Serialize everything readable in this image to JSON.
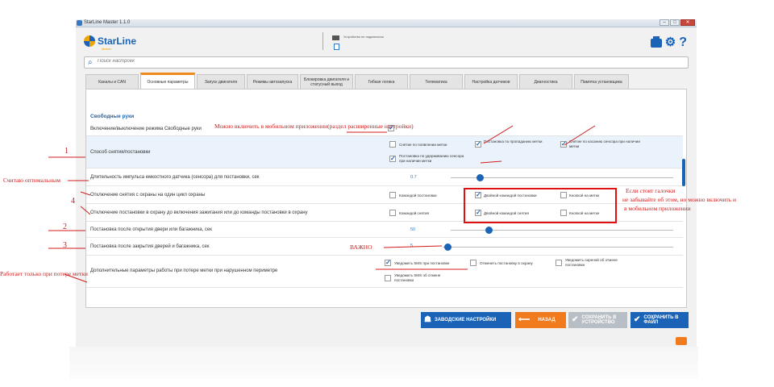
{
  "window": {
    "title": "StarLine Master 1.1.0"
  },
  "app": {
    "brand": "StarLine",
    "brand_sub": "Master",
    "device_status": "Устройство не подключено"
  },
  "search": {
    "placeholder": "Поиск настроек"
  },
  "tabs": [
    {
      "label": "Каналы и CAN",
      "active": false
    },
    {
      "label": "Основные параметры",
      "active": true
    },
    {
      "label": "Запуск двигателя",
      "active": false
    },
    {
      "label": "Режимы автозапуска",
      "active": false
    },
    {
      "label": "Блокировка двигателя и статусный выход",
      "active": false
    },
    {
      "label": "Гибкая логика",
      "active": false
    },
    {
      "label": "Телематика",
      "active": false
    },
    {
      "label": "Настройка датчиков",
      "active": false
    },
    {
      "label": "Диагностика",
      "active": false
    },
    {
      "label": "Памятка установщика",
      "active": false
    }
  ],
  "section": {
    "title": "Свободные руки"
  },
  "rows": {
    "hands_free": {
      "label": "Включение/выключение режима Свободные руки",
      "checked": true
    },
    "method": {
      "label": "Способ снятия/постановки",
      "options": [
        {
          "label": "Снятие по появлении метки",
          "checked": false
        },
        {
          "label": "Постановка по пропаданию метки",
          "checked": true
        },
        {
          "label": "Снятие по касанию сенсора при наличии метки",
          "checked": true
        },
        {
          "label": "Постановка по удерживанию сенсора при наличии метки",
          "checked": true
        }
      ]
    },
    "pulse": {
      "label": "Длительность импульса емкостного датчика (сенсора) для постановки, сек",
      "value": "0.7",
      "fraction": 0.13
    },
    "disarm_once": {
      "label": "Отключение снятия с охраны на один цикл охраны",
      "options": [
        {
          "label": "Командой постановки",
          "checked": false
        },
        {
          "label": "Двойной командой постановки",
          "checked": true
        },
        {
          "label": "Кнопкой на метке",
          "checked": false
        }
      ]
    },
    "arm_off": {
      "label": "Отключение постановки в охрану до включения зажигания или до команды постановки в охрану",
      "options": [
        {
          "label": "Командой снятия",
          "checked": false
        },
        {
          "label": "Двойной командой снятия",
          "checked": true
        },
        {
          "label": "Кнопкой на метке",
          "checked": false
        }
      ]
    },
    "after_open": {
      "label": "Постановка после открытия двери или багажника, сек",
      "value": "50",
      "fraction": 0.17
    },
    "after_close": {
      "label": "Постановка после закрытия дверей и багажника, сек",
      "value": "5",
      "fraction": 0.02
    },
    "tag_loss": {
      "label": "Дополнительные параметры работы при потере метки при нарушенном периметре",
      "options": [
        {
          "label": "Уведомить SMS при постановке",
          "checked": true
        },
        {
          "label": "Отменить постановку в охрану",
          "checked": false
        },
        {
          "label": "Уведомить сиреной об отмене постановки",
          "checked": false
        },
        {
          "label": "Уведомить SMS об отмене постановки",
          "checked": false
        }
      ]
    }
  },
  "buttons": {
    "factory": "ЗАВОДСКИЕ НАСТРОЙКИ",
    "back": "НАЗАД",
    "save_device": "СОХРАНИТЬ В УСТРОЙСТВО",
    "save_file": "СОХРАНИТЬ В ФАЙЛ"
  },
  "annotations": {
    "app_note": "Можно включить в мобильном приложении(раздел расширенные настройки)",
    "n1": "1",
    "optimal": "Считаю оптимальным",
    "n4": "4",
    "n2": "2",
    "n3": "3",
    "important": "ВАЖНО",
    "tag_loss_note": "Работает только при потере метки",
    "checkbox_note_1": "Если стоят галочки",
    "checkbox_note_2": "не забывайте об этом, но можно включить и",
    "checkbox_note_3": "в мобильном приложении"
  },
  "colors": {
    "accent": "#1a63b6",
    "orange": "#f07a1c",
    "annotation": "#d01c1c"
  }
}
